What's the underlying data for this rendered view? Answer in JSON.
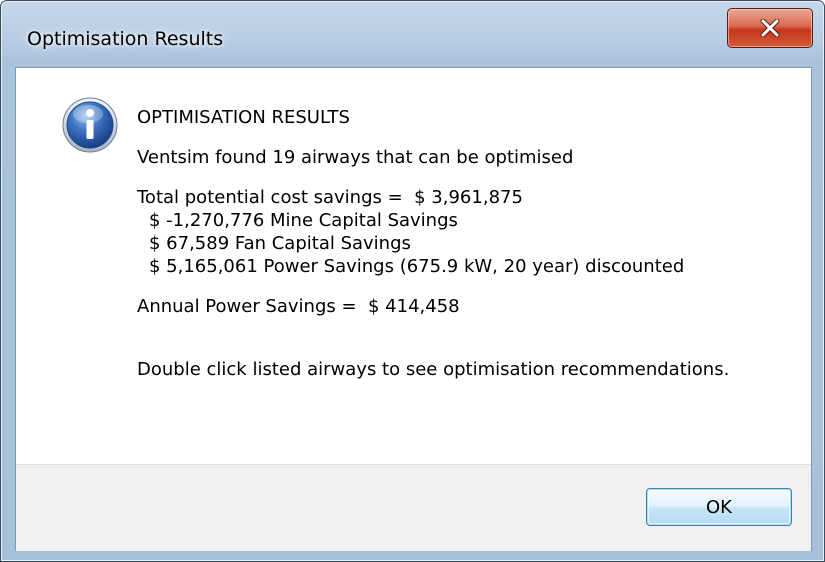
{
  "window": {
    "title": "Optimisation Results"
  },
  "message": {
    "heading": "OPTIMISATION RESULTS",
    "found": "Ventsim found 19 airways that can be optimised",
    "total_savings": "Total potential cost savings =  $ 3,961,875",
    "mine_capital": "$ -1,270,776 Mine Capital Savings",
    "fan_capital": "$ 67,589 Fan Capital Savings",
    "power_savings": "$ 5,165,061 Power Savings (675.9 kW, 20 year) discounted",
    "annual_power": "Annual Power Savings =  $ 414,458",
    "instruction": "Double click listed airways to see optimisation recommendations."
  },
  "buttons": {
    "ok_label": "OK"
  },
  "icons": {
    "close": "close-icon",
    "info": "info-icon"
  },
  "colors": {
    "close_button": "#c4371d",
    "info_icon": "#2d5fa8",
    "ok_border": "#3c7fb1"
  }
}
